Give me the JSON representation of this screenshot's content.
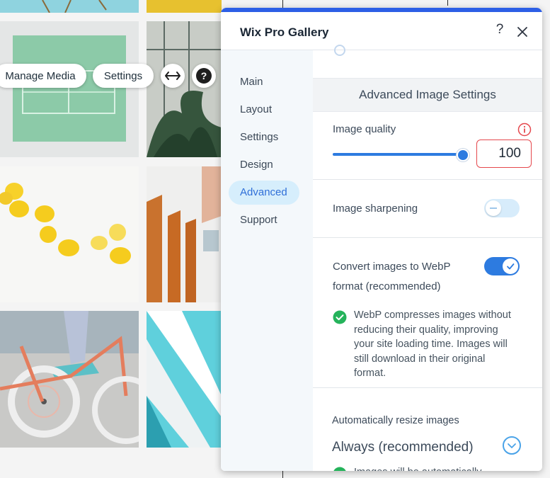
{
  "gallery_toolbar": {
    "manage_media": "Manage Media",
    "settings": "Settings"
  },
  "panel": {
    "title": "Wix Pro Gallery",
    "help_label": "?",
    "nav": [
      {
        "label": "Main",
        "active": false
      },
      {
        "label": "Layout",
        "active": false
      },
      {
        "label": "Settings",
        "active": false
      },
      {
        "label": "Design",
        "active": false
      },
      {
        "label": "Advanced",
        "active": true
      },
      {
        "label": "Support",
        "active": false
      }
    ],
    "section_title": "Advanced Image Settings",
    "image_quality": {
      "label": "Image quality",
      "value": "100",
      "fraction": 1.0
    },
    "image_sharpening": {
      "label": "Image sharpening",
      "enabled": false
    },
    "webp": {
      "label_line1": "Convert images to WebP",
      "label_line2": "format (recommended)",
      "enabled": true,
      "notice": [
        "WebP compresses images without",
        "reducing their quality, improving",
        "your site loading time. Images will",
        "still download in their original",
        "format."
      ]
    },
    "resize": {
      "label": "Automatically resize images",
      "value": "Always (recommended)",
      "notice_partial": "Images will be automatically"
    }
  },
  "colors": {
    "accent": "#2d7be0",
    "topbar": "#2d5fe6",
    "error": "#e5484d",
    "success": "#25b35b",
    "nav_active_bg": "#d6eefc"
  }
}
